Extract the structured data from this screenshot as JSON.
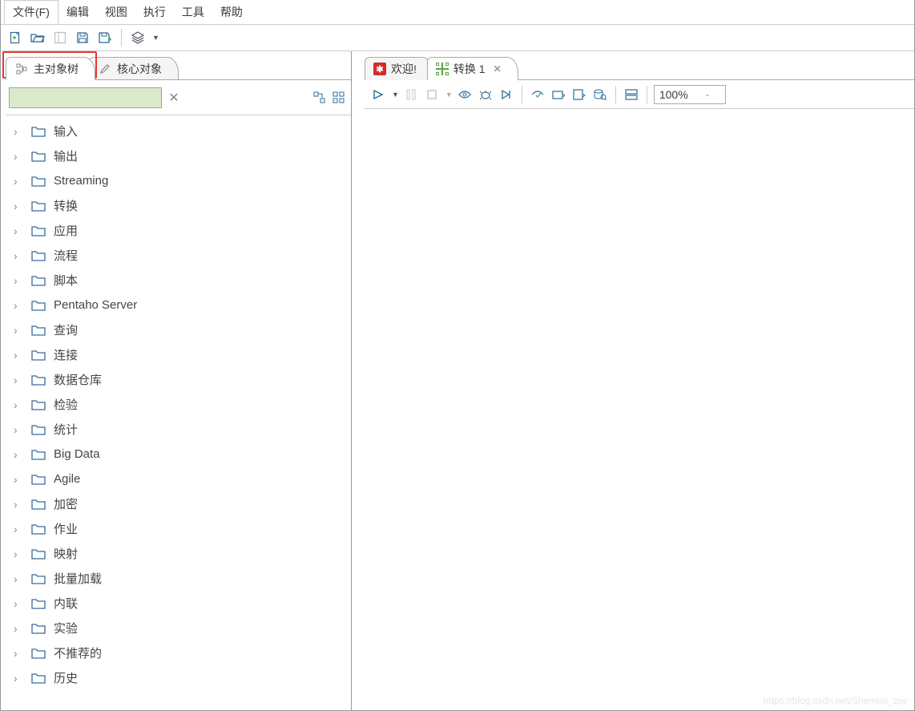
{
  "menu": {
    "file": "文件(F)",
    "edit": "编辑",
    "view": "视图",
    "execute": "执行",
    "tools": "工具",
    "help": "帮助"
  },
  "left_tabs": {
    "main_tree": "主对象树",
    "core_objects": "核心对象"
  },
  "filter": {
    "value": "",
    "clear": "✕"
  },
  "tree": {
    "items": [
      {
        "label": "输入"
      },
      {
        "label": "输出"
      },
      {
        "label": "Streaming"
      },
      {
        "label": "转换"
      },
      {
        "label": "应用"
      },
      {
        "label": "流程"
      },
      {
        "label": "脚本"
      },
      {
        "label": "Pentaho Server"
      },
      {
        "label": "查询"
      },
      {
        "label": "连接"
      },
      {
        "label": "数据仓库"
      },
      {
        "label": "检验"
      },
      {
        "label": "统计"
      },
      {
        "label": "Big Data"
      },
      {
        "label": "Agile"
      },
      {
        "label": "加密"
      },
      {
        "label": "作业"
      },
      {
        "label": "映射"
      },
      {
        "label": "批量加载"
      },
      {
        "label": "内联"
      },
      {
        "label": "实验"
      },
      {
        "label": "不推荐的"
      },
      {
        "label": "历史"
      }
    ]
  },
  "right_tabs": {
    "welcome": "欢迎!",
    "trans1": "转换 1"
  },
  "zoom": {
    "value": "100%"
  },
  "watermark": "https://blog.csdn.net/Shemon_zjw"
}
